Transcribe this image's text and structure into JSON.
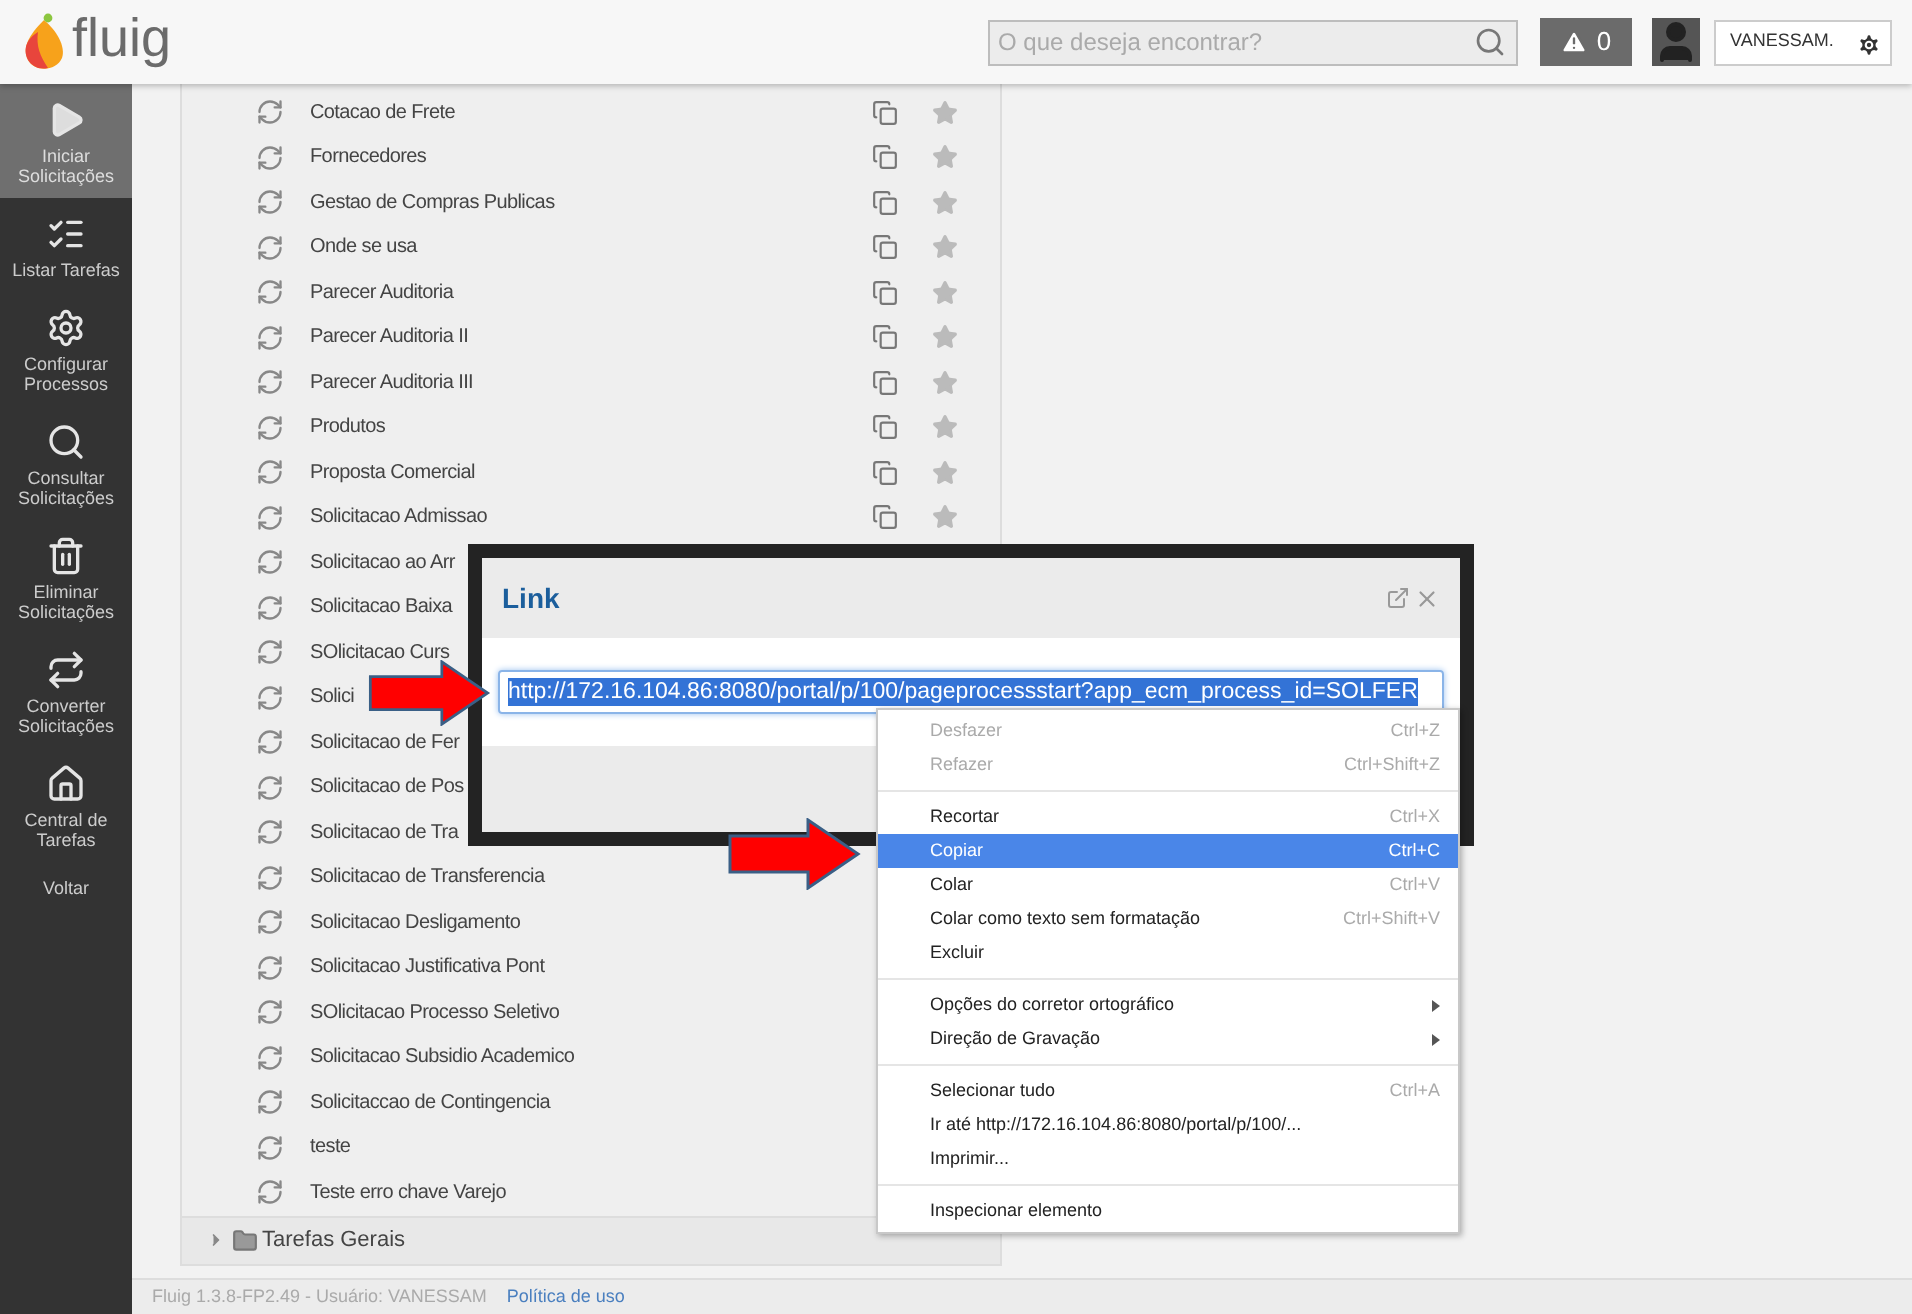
{
  "header": {
    "logo": "fluig",
    "search": {
      "placeholder": "O que deseja encontrar?"
    },
    "alerts": "0",
    "user": "VANESSAM."
  },
  "sidebar": {
    "items": [
      {
        "label": "Iniciar Solicitações",
        "selected": true
      },
      {
        "label": "Listar Tarefas",
        "selected": false
      },
      {
        "label": "Configurar Processos",
        "selected": false
      },
      {
        "label": "Consultar Solicitações",
        "selected": false
      },
      {
        "label": "Eliminar Solicitações",
        "selected": false
      },
      {
        "label": "Converter Solicitações",
        "selected": false
      },
      {
        "label": "Central de Tarefas",
        "selected": false
      },
      {
        "label": "Voltar",
        "selected": false
      }
    ]
  },
  "processes": [
    {
      "label": "Cotacao de Frete",
      "actions": true
    },
    {
      "label": "Fornecedores",
      "actions": true
    },
    {
      "label": "Gestao de Compras Publicas",
      "actions": true
    },
    {
      "label": "Onde se usa",
      "actions": true
    },
    {
      "label": "Parecer Auditoria",
      "actions": true
    },
    {
      "label": "Parecer Auditoria II",
      "actions": true
    },
    {
      "label": "Parecer Auditoria III",
      "actions": true
    },
    {
      "label": "Produtos",
      "actions": true
    },
    {
      "label": "Proposta Comercial",
      "actions": true
    },
    {
      "label": "Solicitacao Admissao",
      "actions": true
    },
    {
      "label": "Solicitacao ao Arr"
    },
    {
      "label": "Solicitacao Baixa"
    },
    {
      "label": "SOlicitacao Curs"
    },
    {
      "label": "Solici"
    },
    {
      "label": "Solicitacao de Fer"
    },
    {
      "label": "Solicitacao de Pos"
    },
    {
      "label": "Solicitacao de Tra"
    },
    {
      "label": "Solicitacao de Transferencia",
      "actions": false
    },
    {
      "label": "Solicitacao Desligamento",
      "actions": false
    },
    {
      "label": "Solicitacao Justificativa Pont",
      "actions": false
    },
    {
      "label": "SOlicitacao Processo Seletivo",
      "actions": false
    },
    {
      "label": "Solicitacao Subsidio Academico",
      "actions": false
    },
    {
      "label": "Solicitaccao de Contingencia",
      "actions": false
    },
    {
      "label": "teste",
      "actions": false
    },
    {
      "label": "Teste erro chave Varejo",
      "actions": false
    }
  ],
  "group": {
    "label": "Tarefas Gerais",
    "expanded": false
  },
  "dialog": {
    "title": "Link",
    "url": "http://172.16.104.86:8080/portal/p/100/pageprocessstart?app_ecm_process_id=SOLFER"
  },
  "context_menu": [
    {
      "kind": "item",
      "label": "Desfazer",
      "shortcut": "Ctrl+Z",
      "disabled": true,
      "selected": false
    },
    {
      "kind": "item",
      "label": "Refazer",
      "shortcut": "Ctrl+Shift+Z",
      "disabled": true,
      "selected": false
    },
    {
      "kind": "separator"
    },
    {
      "kind": "item",
      "label": "Recortar",
      "shortcut": "Ctrl+X",
      "disabled": false,
      "selected": false
    },
    {
      "kind": "item",
      "label": "Copiar",
      "shortcut": "Ctrl+C",
      "disabled": false,
      "selected": true
    },
    {
      "kind": "item",
      "label": "Colar",
      "shortcut": "Ctrl+V",
      "disabled": false,
      "selected": false
    },
    {
      "kind": "item",
      "label": "Colar como texto sem formatação",
      "shortcut": "Ctrl+Shift+V",
      "disabled": false,
      "selected": false
    },
    {
      "kind": "item",
      "label": "Excluir",
      "disabled": false,
      "selected": false
    },
    {
      "kind": "separator"
    },
    {
      "kind": "submenu",
      "label": "Opções do corretor ortográfico",
      "disabled": false,
      "selected": false
    },
    {
      "kind": "submenu",
      "label": "Direção de Gravação",
      "disabled": false,
      "selected": false
    },
    {
      "kind": "separator"
    },
    {
      "kind": "item",
      "label": "Selecionar tudo",
      "shortcut": "Ctrl+A",
      "disabled": false,
      "selected": false
    },
    {
      "kind": "item",
      "label": "Ir até http://172.16.104.86:8080/portal/p/100/...",
      "disabled": false,
      "selected": false
    },
    {
      "kind": "item",
      "label": "Imprimir...",
      "disabled": false,
      "selected": false
    },
    {
      "kind": "separator"
    },
    {
      "kind": "item",
      "label": "Inspecionar elemento",
      "disabled": false,
      "selected": false
    }
  ],
  "footer": {
    "text": "Fluig 1.3.8-FP2.49 - Usuário: VANESSAM",
    "link": "Política de uso"
  }
}
